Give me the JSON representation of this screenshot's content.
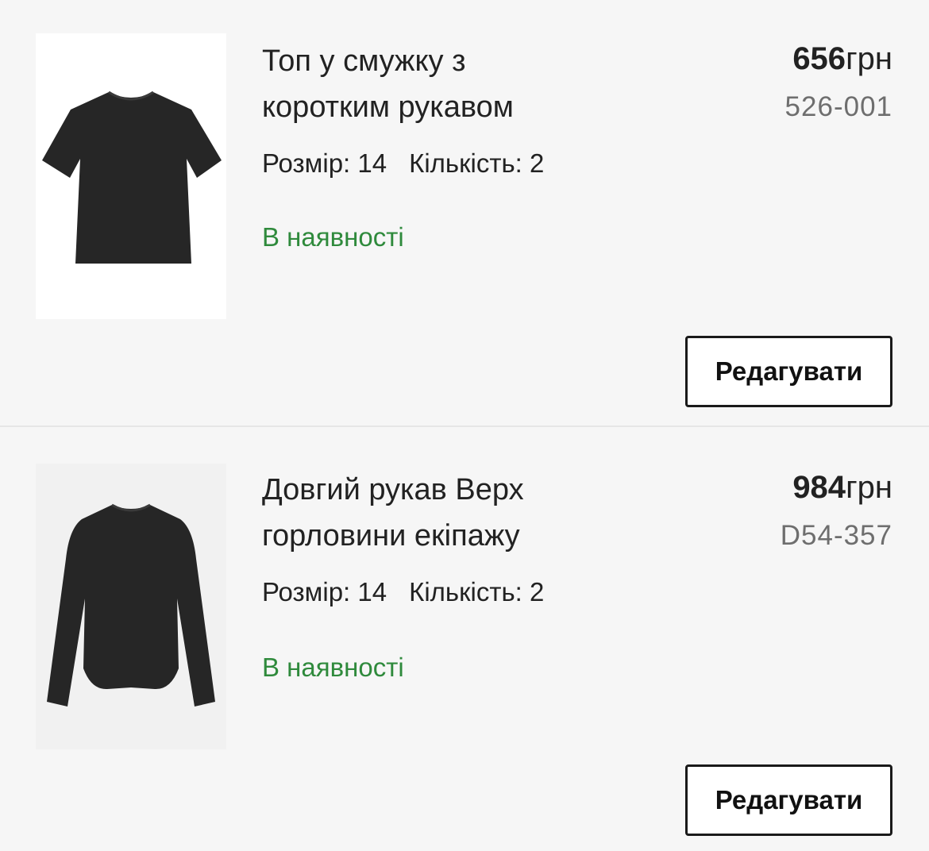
{
  "items": [
    {
      "title": "Топ у смужку з коротким рукавом",
      "size_text": "Розмір: 14",
      "quantity_text": "Кількість: 2",
      "stock_status": "В наявності",
      "price_amount": "656",
      "price_currency": "грн",
      "product_code": "526-001",
      "edit_label": "Редагувати",
      "image_icon": "short-sleeve-tshirt"
    },
    {
      "title": "Довгий рукав Верх горловини екіпажу",
      "size_text": "Розмір: 14",
      "quantity_text": "Кількість: 2",
      "stock_status": "В наявності",
      "price_amount": "984",
      "price_currency": "грн",
      "product_code": "D54-357",
      "edit_label": "Редагувати",
      "image_icon": "long-sleeve-top"
    }
  ],
  "colors": {
    "background": "#f6f6f6",
    "stock_green": "#2f8a3c",
    "code_grey": "#6e6e6e",
    "garment": "#262626"
  }
}
